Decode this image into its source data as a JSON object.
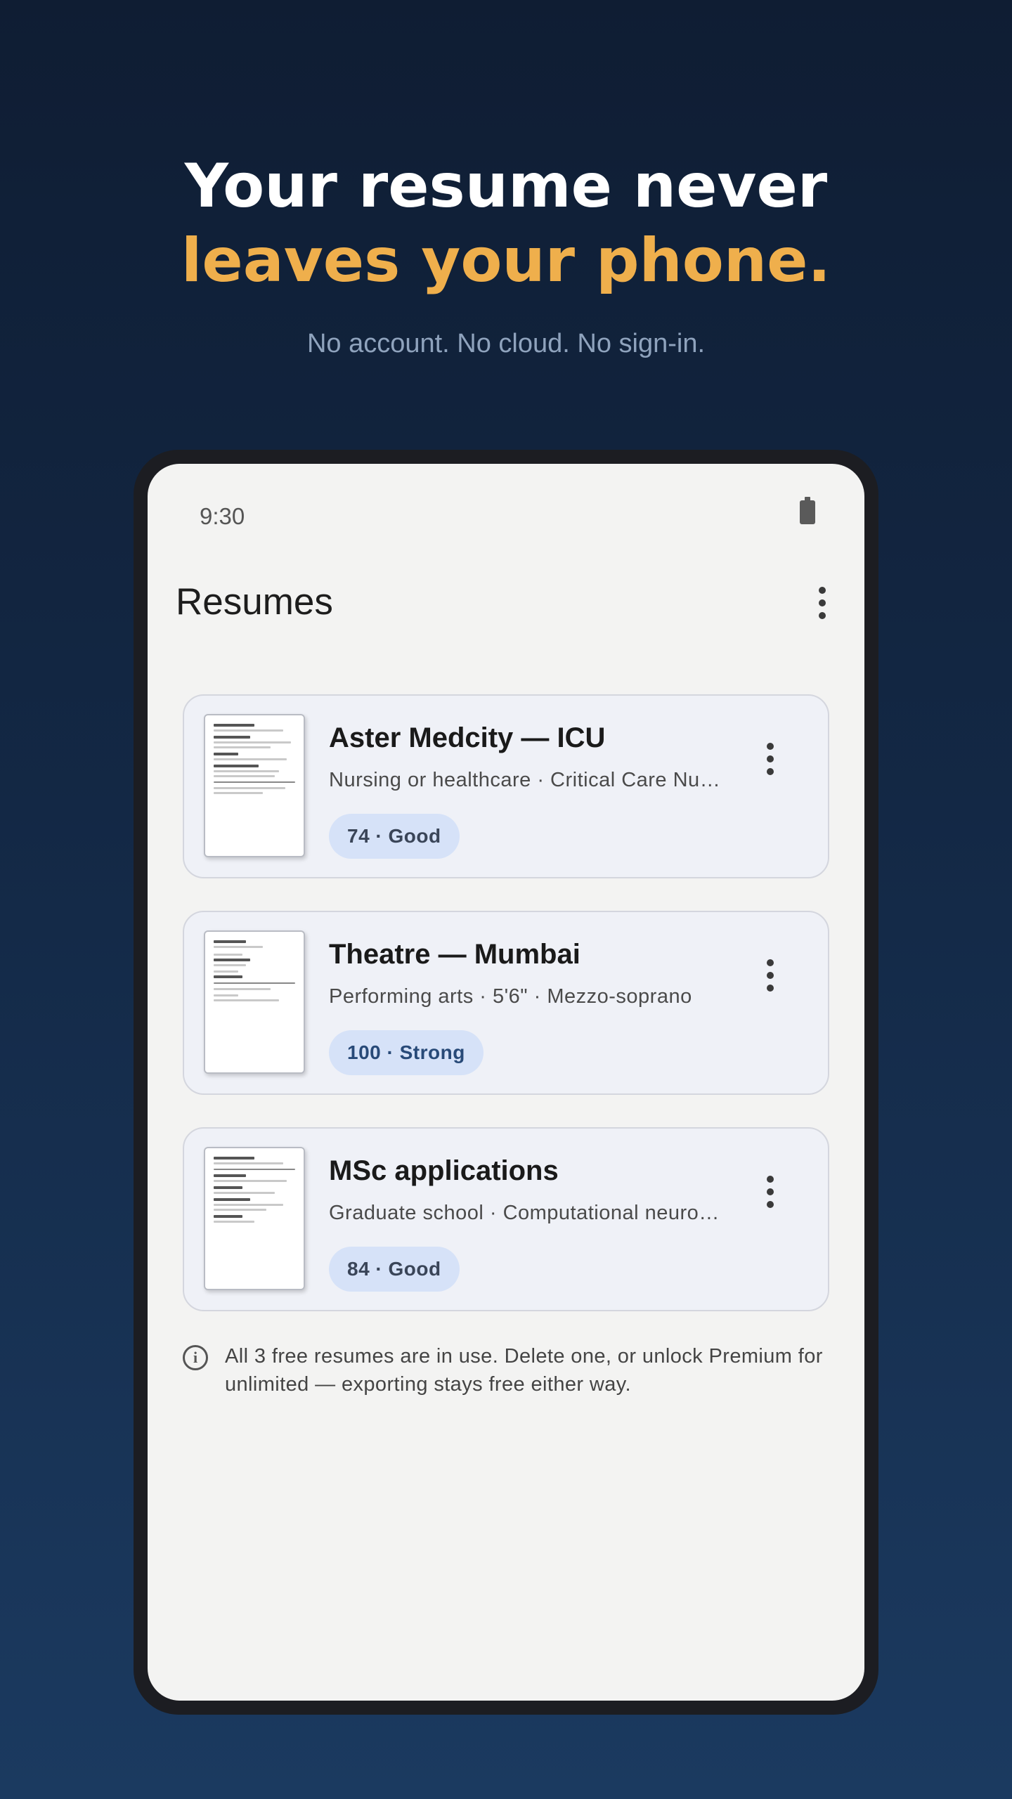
{
  "hero": {
    "line1": "Your resume never",
    "line2": "leaves your phone.",
    "subtitle": "No account. No cloud. No sign-in."
  },
  "status_bar": {
    "time": "9:30",
    "battery_icon": "battery-icon"
  },
  "app": {
    "title": "Resumes",
    "menu_icon": "more-vert-icon"
  },
  "resumes": [
    {
      "title": "Aster Medcity — ICU",
      "subtitle": "Nursing or healthcare · Critical Care Nurse",
      "badge": "74 · Good"
    },
    {
      "title": "Theatre — Mumbai",
      "subtitle": "Performing arts · 5'6\" · Mezzo-soprano",
      "badge": "100 · Strong"
    },
    {
      "title": "MSc applications",
      "subtitle": "Graduate school · Computational neuroscience",
      "badge": "84 · Good"
    }
  ],
  "info": {
    "icon": "info-icon",
    "text": "All 3 free resumes are in use. Delete one, or unlock Premium for unlimited — exporting stays free either way."
  },
  "colors": {
    "accent": "#efaf4c",
    "badge_bg": "#d6e2f8",
    "card_bg": "#eff1f7"
  }
}
